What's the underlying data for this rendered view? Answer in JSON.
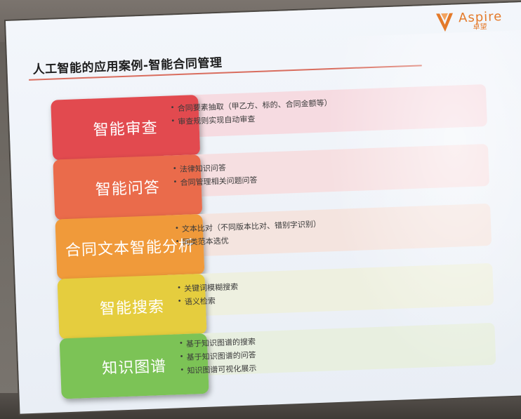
{
  "slide": {
    "title": "人工智能的应用案例-智能合同管理",
    "logo": {
      "word": "Aspire",
      "cn": "卓望"
    }
  },
  "rows": [
    {
      "label": "智能审查",
      "color": "#e24a4f",
      "panel_color": "#f6dbe1",
      "bullets": [
        "合同要素抽取（甲乙方、标的、合同金额等）",
        "审查规则实现自动审查"
      ]
    },
    {
      "label": "智能问答",
      "color": "#ea6b4b",
      "panel_color": "#f6dfe1",
      "bullets": [
        "法律知识问答",
        "合同管理相关问题问答"
      ]
    },
    {
      "label": "合同文本智能分析",
      "color": "#f09a3a",
      "panel_color": "#f4e4df",
      "bullets": [
        "文本比对（不同版本比对、错别字识别）",
        "同类范本选优"
      ]
    },
    {
      "label": "智能搜索",
      "color": "#e5cd3e",
      "panel_color": "#eef0e0",
      "bullets": [
        "关键词模糊搜索",
        "语义检索"
      ]
    },
    {
      "label": "知识图谱",
      "color": "#7cc356",
      "panel_color": "#e8efe0",
      "bullets": [
        "基于知识图谱的搜索",
        "基于知识图谱的问答",
        "知识图谱可视化展示"
      ]
    }
  ]
}
